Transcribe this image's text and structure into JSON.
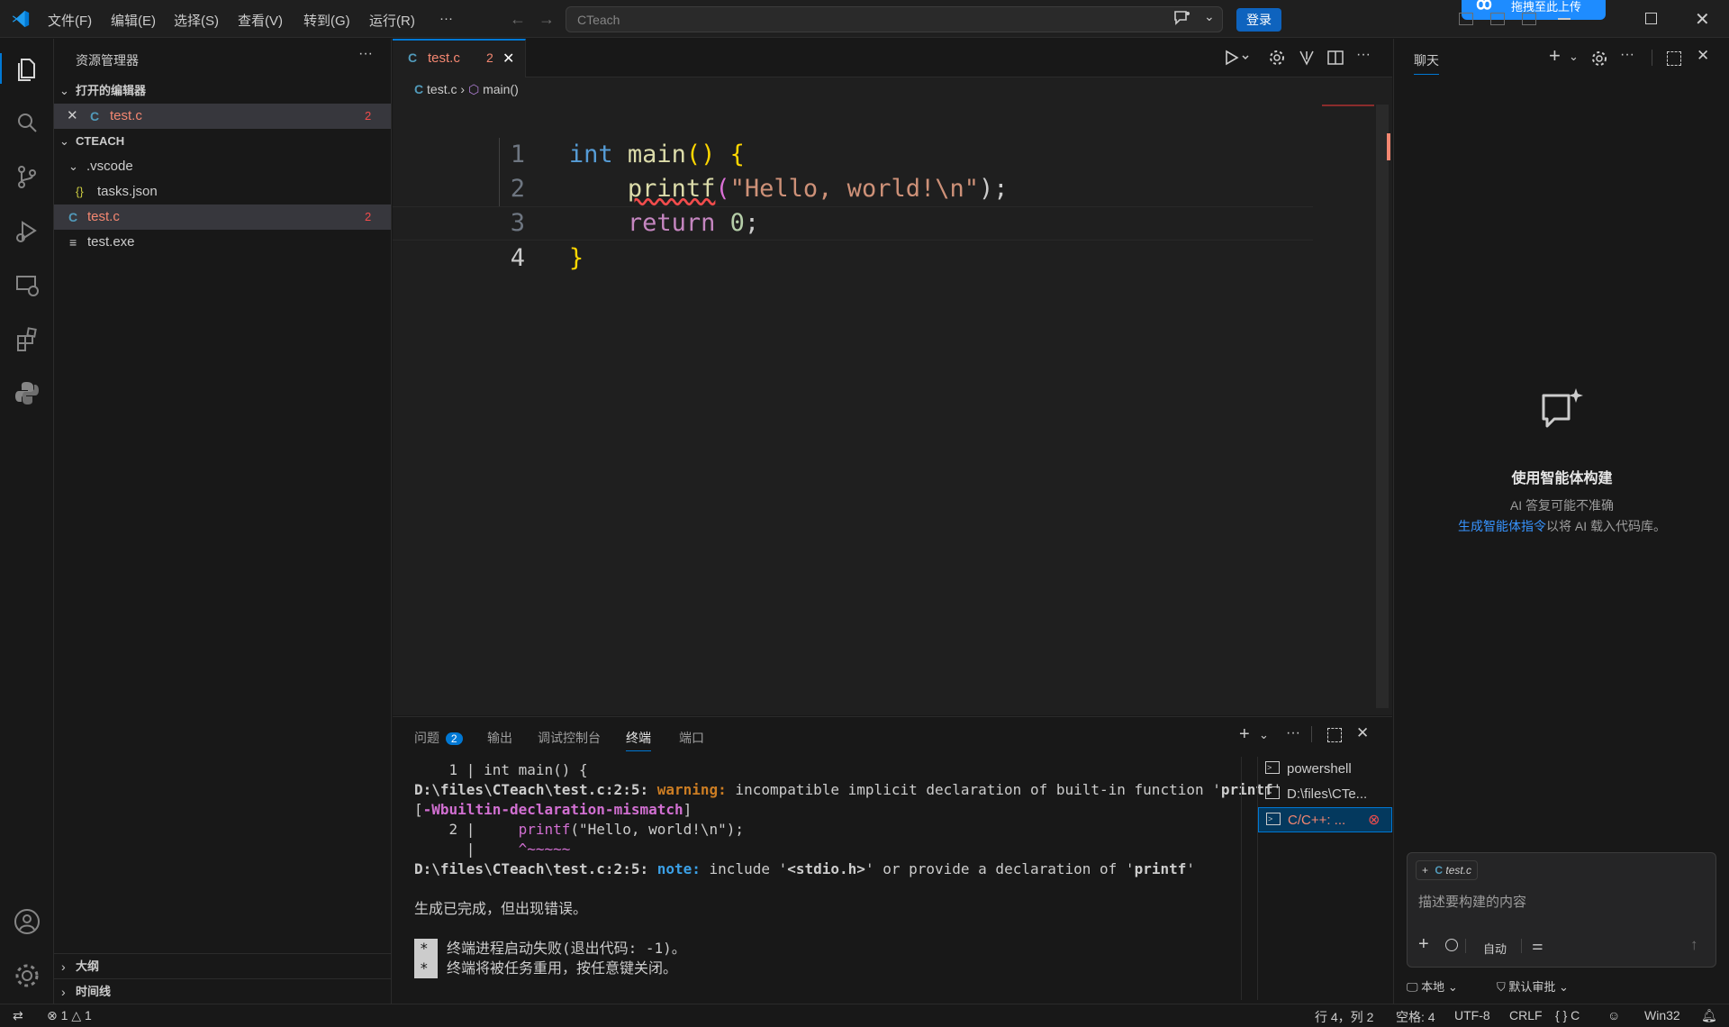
{
  "titlebar": {
    "menus": [
      "文件(F)",
      "编辑(E)",
      "选择(S)",
      "查看(V)",
      "转到(G)",
      "运行(R)",
      "···"
    ],
    "search_text": "CTeach",
    "login_label": "登录",
    "floating_widget_text": "拖拽至此上传"
  },
  "sidebar": {
    "title": "资源管理器",
    "open_editors_header": "打开的编辑器",
    "open_editors": [
      {
        "name": "test.c",
        "badge": "2"
      }
    ],
    "workspace_header": "CTEACH",
    "tree": [
      {
        "name": ".vscode",
        "type": "folder"
      },
      {
        "name": "tasks.json",
        "type": "json"
      },
      {
        "name": "test.c",
        "type": "c",
        "badge": "2"
      },
      {
        "name": "test.exe",
        "type": "file"
      }
    ],
    "outline_header": "大纲",
    "timeline_header": "时间线"
  },
  "editor": {
    "tab": {
      "label": "test.c",
      "badge": "2"
    },
    "breadcrumb": {
      "file": "test.c",
      "symbol": "main()"
    },
    "line_numbers": [
      "1",
      "2",
      "3",
      "4"
    ],
    "code": {
      "l1_kw": "int",
      "l1_fn": "main",
      "l1_rest": "() {",
      "l2_fn": "printf",
      "l2_open": "(",
      "l2_str": "\"Hello, world!\\n\"",
      "l2_close": ");",
      "l3_kw": "return",
      "l3_num": "0",
      "l3_end": ";",
      "l4": "}"
    }
  },
  "panel": {
    "tabs": [
      {
        "label": "问题",
        "badge": "2"
      },
      {
        "label": "输出"
      },
      {
        "label": "调试控制台"
      },
      {
        "label": "终端",
        "active": true
      },
      {
        "label": "端口"
      }
    ],
    "terminal": {
      "l1": "    1 | int main() {",
      "l2_path": "D:\\files\\CTeach\\test.c:2:5:",
      "l2_warn": "warning:",
      "l2_msg1": " incompatible implicit declaration of built-in function '",
      "l2_printf": "printf",
      "l2_msg2": "'",
      "l3_open": "[",
      "l3_flag": "-Wbuiltin-declaration-mismatch",
      "l3_close": "]",
      "l4_pre": "    2 |     ",
      "l4_fn": "printf",
      "l4_rest": "(\"Hello, world!\\n\");",
      "l5_pre": "      |     ",
      "l5_caret": "^~~~~~",
      "l6_path": "D:\\files\\CTeach\\test.c:2:5:",
      "l6_note": "note:",
      "l6_msg1": " include '",
      "l6_header": "<stdio.h>",
      "l6_msg2": "' or provide a declaration of '",
      "l6_printf": "printf",
      "l6_msg3": "'",
      "l8": "生成已完成，但出现错误。",
      "l10_star": "*",
      "l10": "终端进程启动失败(退出代码: -1)。",
      "l11_star": "*",
      "l11": "终端将被任务重用，按任意键关闭。"
    },
    "terminal_list": [
      {
        "label": "powershell"
      },
      {
        "label": "D:\\files\\CTe..."
      },
      {
        "label": "C/C++: ...",
        "selected": true
      }
    ]
  },
  "chat": {
    "title": "聊天",
    "heading": "使用智能体构建",
    "subtitle": "AI 答复可能不准确",
    "link_text": "生成智能体指令",
    "link_suffix": "以将 AI 载入代码库。",
    "context_file": "test.c",
    "input_placeholder": "描述要构建的内容",
    "mode_label": "自动",
    "footer_left": "本地",
    "footer_right": "默认审批"
  },
  "statusbar": {
    "errors": "1",
    "warnings": "1",
    "position": "行 4，列 2",
    "spaces": "空格: 4",
    "encoding": "UTF-8",
    "eol": "CRLF",
    "language": "C",
    "platform": "Win32"
  },
  "colors": {
    "accent": "#0078d4",
    "error": "#f14c4c",
    "warning_text": "#f48771",
    "terminal_warning": "#cc7d23",
    "terminal_note": "#3ba0e6",
    "terminal_flag": "#d16fd1",
    "link": "#3794ff"
  }
}
